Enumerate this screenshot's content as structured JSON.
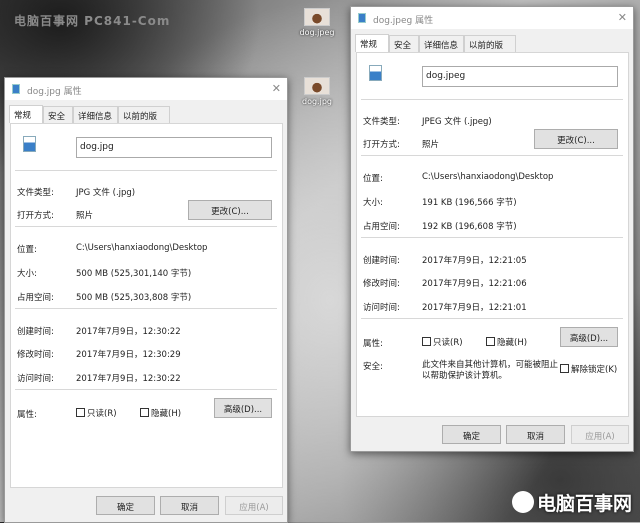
{
  "watermark": "电脑百事网 PC841-Com",
  "desktop_icons": [
    {
      "label": "dog.jpeg"
    },
    {
      "label": "dog.jpg"
    }
  ],
  "logo": "电脑百事网",
  "dialogs": [
    {
      "title": "dog.jpg 属性",
      "tabs": [
        "常规",
        "安全",
        "详细信息",
        "以前的版本"
      ],
      "filename": "dog.jpg",
      "labels": {
        "type": "文件类型:",
        "open": "打开方式:",
        "location": "位置:",
        "size": "大小:",
        "disk": "占用空间:",
        "created": "创建时间:",
        "modified": "修改时间:",
        "accessed": "访问时间:",
        "attributes": "属性:"
      },
      "values": {
        "type": "JPG 文件 (.jpg)",
        "open": "照片",
        "location": "C:\\Users\\hanxiaodong\\Desktop",
        "size": "500 MB (525,301,140 字节)",
        "disk": "500 MB (525,303,808 字节)",
        "created": "2017年7月9日，12:30:22",
        "modified": "2017年7月9日，12:30:29",
        "accessed": "2017年7月9日，12:30:22"
      },
      "change": "更改(C)...",
      "readonly": "只读(R)",
      "hidden": "隐藏(H)",
      "advanced": "高级(D)...",
      "ok": "确定",
      "cancel": "取消",
      "apply": "应用(A)"
    },
    {
      "title": "dog.jpeg 属性",
      "tabs": [
        "常规",
        "安全",
        "详细信息",
        "以前的版本"
      ],
      "filename": "dog.jpeg",
      "labels": {
        "type": "文件类型:",
        "open": "打开方式:",
        "location": "位置:",
        "size": "大小:",
        "disk": "占用空间:",
        "created": "创建时间:",
        "modified": "修改时间:",
        "accessed": "访问时间:",
        "attributes": "属性:",
        "security": "安全:"
      },
      "values": {
        "type": "JPEG 文件 (.jpeg)",
        "open": "照片",
        "location": "C:\\Users\\hanxiaodong\\Desktop",
        "size": "191 KB (196,566 字节)",
        "disk": "192 KB (196,608 字节)",
        "created": "2017年7月9日，12:21:05",
        "modified": "2017年7月9日，12:21:06",
        "accessed": "2017年7月9日，12:21:01"
      },
      "security_text": "此文件来自其他计算机，可能被阻止以帮助保护该计算机。",
      "unblock": "解除锁定(K)",
      "change": "更改(C)...",
      "readonly": "只读(R)",
      "hidden": "隐藏(H)",
      "advanced": "高级(D)...",
      "ok": "确定",
      "cancel": "取消",
      "apply": "应用(A)"
    }
  ]
}
